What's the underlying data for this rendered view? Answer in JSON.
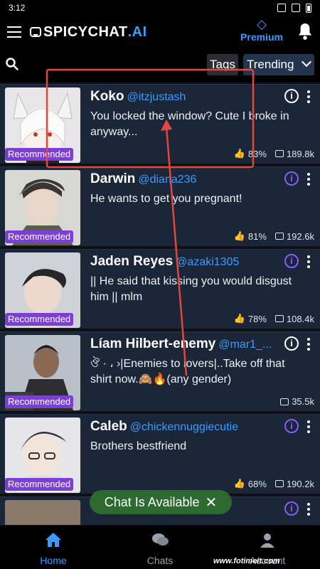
{
  "status": {
    "time": "3:12"
  },
  "header": {
    "logo_text": "SPICYCHAT",
    "logo_ai": ".AI",
    "premium_label": "Premium",
    "icons": [
      "menu-icon",
      "diamond-icon",
      "bell-icon"
    ]
  },
  "filters": {
    "tags_label": "Tags",
    "sort_label": "Trending"
  },
  "cards": [
    {
      "name": "Koko",
      "handle": "@itzjustash",
      "description": "You locked the window? Cute I broke in anyway...",
      "badge": "Recommended",
      "rating": "83%",
      "chats": "189.8k",
      "info_color": "white"
    },
    {
      "name": "Darwin",
      "handle": "@diana236",
      "description": "He wants to get you pregnant!",
      "badge": "Recommended",
      "rating": "81%",
      "chats": "192.6k",
      "info_color": "purple"
    },
    {
      "name": "Jaden Reyes",
      "handle": "@azaki1305",
      "description": "|| He said that kissing you would disgust him || mlm",
      "badge": "Recommended",
      "rating": "78%",
      "chats": "108.4k",
      "info_color": "purple"
    },
    {
      "name": "Líam Hilbert-enemy",
      "handle": "@mar1_...",
      "description": "ঔ · ، ›|Enemies to lovers|..Take off that shirt now.🙈🔥(any gender)",
      "badge": "Recommended",
      "rating": "",
      "chats": "35.5k",
      "info_color": "white"
    },
    {
      "name": "Caleb",
      "handle": "@chickennuggiecutie",
      "description": "Brothers bestfriend",
      "badge": "Recommended",
      "rating": "68%",
      "chats": "190.2k",
      "info_color": "purple"
    }
  ],
  "toast": {
    "label": "Chat Is Available"
  },
  "nav": {
    "home": "Home",
    "chats": "Chats",
    "account": "Account"
  },
  "watermark": {
    "url": "www.fotimeit.com"
  },
  "colors": {
    "accent": "#3b9cff",
    "badge": "#7b3fd8",
    "card_bg": "#1b2638",
    "toast_bg": "#2c6a30",
    "annotation": "#e4483c"
  }
}
